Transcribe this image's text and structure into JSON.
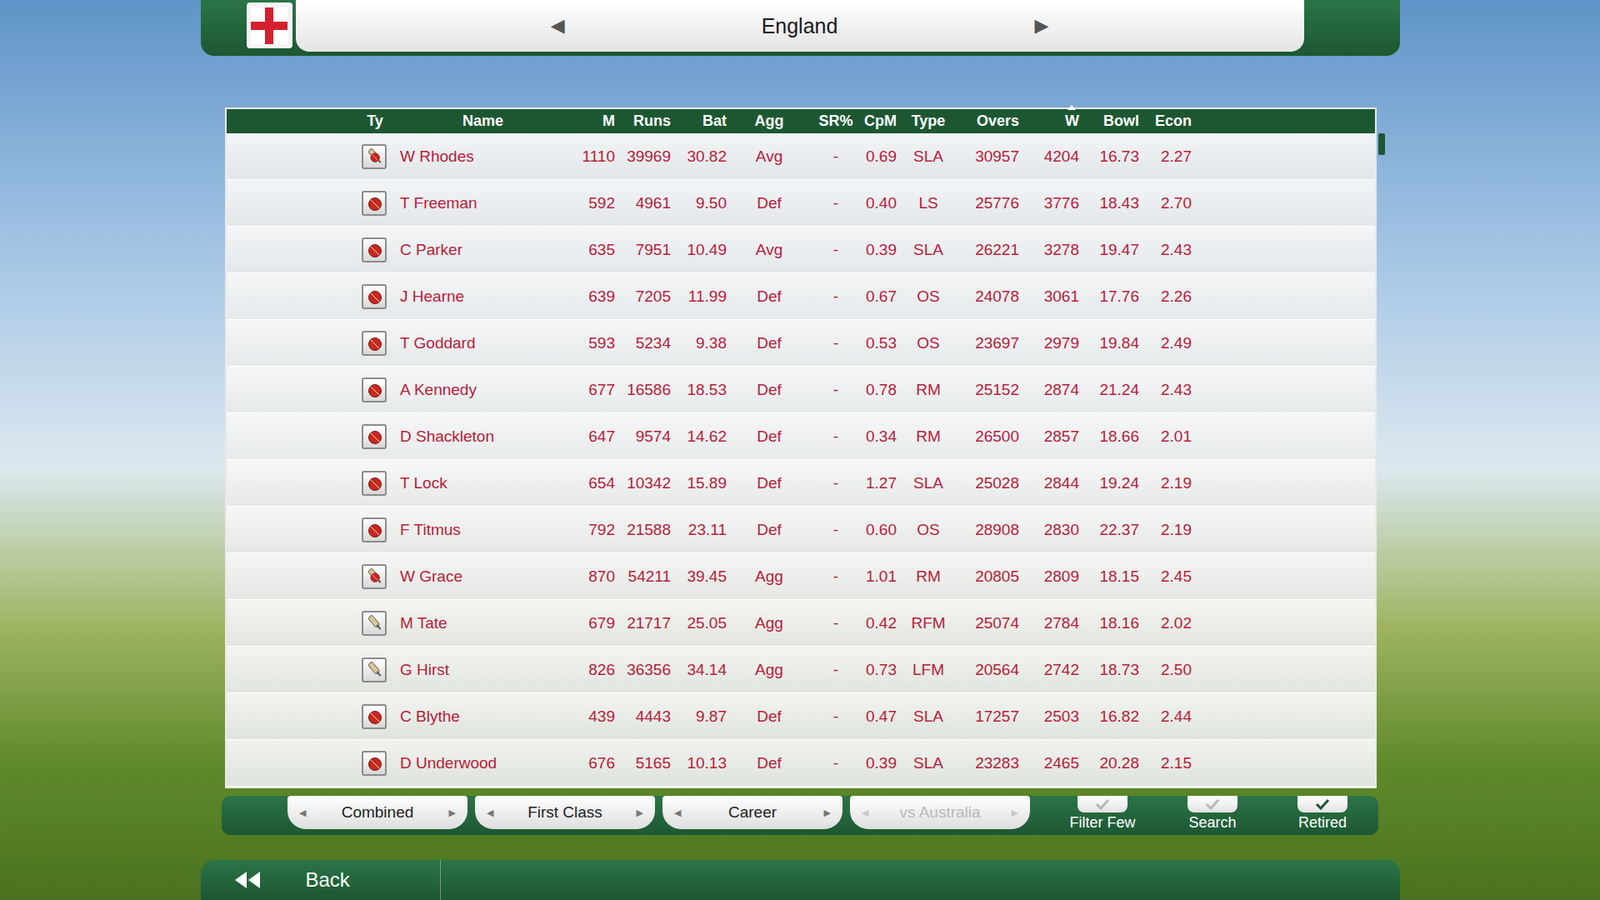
{
  "header": {
    "title": "England",
    "prev": "◀",
    "next": "▶"
  },
  "table": {
    "columns": [
      {
        "label": "Ty",
        "sorted": false
      },
      {
        "label": "Name",
        "sorted": false
      },
      {
        "label": "M",
        "sorted": false
      },
      {
        "label": "Runs",
        "sorted": false
      },
      {
        "label": "Bat",
        "sorted": false
      },
      {
        "label": "Agg",
        "sorted": false
      },
      {
        "label": "SR%",
        "sorted": false
      },
      {
        "label": "CpM",
        "sorted": false
      },
      {
        "label": "Type",
        "sorted": false
      },
      {
        "label": "Overs",
        "sorted": false
      },
      {
        "label": "W",
        "sorted": true
      },
      {
        "label": "Bowl",
        "sorted": false
      },
      {
        "label": "Econ",
        "sorted": false
      }
    ],
    "rows": [
      {
        "kind": "allrounder",
        "cells": [
          "W Rhodes",
          "1110",
          "39969",
          "30.82",
          "Avg",
          "-",
          "0.69",
          "SLA",
          "30957",
          "4204",
          "16.73",
          "2.27"
        ]
      },
      {
        "kind": "bowler",
        "cells": [
          "T Freeman",
          "592",
          "4961",
          "9.50",
          "Def",
          "-",
          "0.40",
          "LS",
          "25776",
          "3776",
          "18.43",
          "2.70"
        ]
      },
      {
        "kind": "bowler",
        "cells": [
          "C Parker",
          "635",
          "7951",
          "10.49",
          "Avg",
          "-",
          "0.39",
          "SLA",
          "26221",
          "3278",
          "19.47",
          "2.43"
        ]
      },
      {
        "kind": "bowler",
        "cells": [
          "J Hearne",
          "639",
          "7205",
          "11.99",
          "Def",
          "-",
          "0.67",
          "OS",
          "24078",
          "3061",
          "17.76",
          "2.26"
        ]
      },
      {
        "kind": "bowler",
        "cells": [
          "T Goddard",
          "593",
          "5234",
          "9.38",
          "Def",
          "-",
          "0.53",
          "OS",
          "23697",
          "2979",
          "19.84",
          "2.49"
        ]
      },
      {
        "kind": "bowler",
        "cells": [
          "A Kennedy",
          "677",
          "16586",
          "18.53",
          "Def",
          "-",
          "0.78",
          "RM",
          "25152",
          "2874",
          "21.24",
          "2.43"
        ]
      },
      {
        "kind": "bowler",
        "cells": [
          "D Shackleton",
          "647",
          "9574",
          "14.62",
          "Def",
          "-",
          "0.34",
          "RM",
          "26500",
          "2857",
          "18.66",
          "2.01"
        ]
      },
      {
        "kind": "bowler",
        "cells": [
          "T Lock",
          "654",
          "10342",
          "15.89",
          "Def",
          "-",
          "1.27",
          "SLA",
          "25028",
          "2844",
          "19.24",
          "2.19"
        ]
      },
      {
        "kind": "bowler",
        "cells": [
          "F Titmus",
          "792",
          "21588",
          "23.11",
          "Def",
          "-",
          "0.60",
          "OS",
          "28908",
          "2830",
          "22.37",
          "2.19"
        ]
      },
      {
        "kind": "allrounder",
        "cells": [
          "W Grace",
          "870",
          "54211",
          "39.45",
          "Agg",
          "-",
          "1.01",
          "RM",
          "20805",
          "2809",
          "18.15",
          "2.45"
        ]
      },
      {
        "kind": "batsman",
        "cells": [
          "M Tate",
          "679",
          "21717",
          "25.05",
          "Agg",
          "-",
          "0.42",
          "RFM",
          "25074",
          "2784",
          "18.16",
          "2.02"
        ]
      },
      {
        "kind": "batsman",
        "cells": [
          "G Hirst",
          "826",
          "36356",
          "34.14",
          "Agg",
          "-",
          "0.73",
          "LFM",
          "20564",
          "2742",
          "18.73",
          "2.50"
        ]
      },
      {
        "kind": "bowler",
        "cells": [
          "C Blythe",
          "439",
          "4443",
          "9.87",
          "Def",
          "-",
          "0.47",
          "SLA",
          "17257",
          "2503",
          "16.82",
          "2.44"
        ]
      },
      {
        "kind": "bowler",
        "cells": [
          "D Underwood",
          "676",
          "5165",
          "10.13",
          "Def",
          "-",
          "0.39",
          "SLA",
          "23283",
          "2465",
          "20.28",
          "2.15"
        ]
      }
    ]
  },
  "filters": [
    {
      "label": "Combined",
      "disabled": false,
      "prev": "◀",
      "next": "▶"
    },
    {
      "label": "First Class",
      "disabled": false,
      "prev": "◀",
      "next": "▶"
    },
    {
      "label": "Career",
      "disabled": false,
      "prev": "◀",
      "next": "▶"
    },
    {
      "label": "vs Australia",
      "disabled": true,
      "prev": "◀",
      "next": "▶"
    }
  ],
  "toggles": [
    {
      "label": "Filter Few",
      "checked": false
    },
    {
      "label": "Search",
      "checked": false
    },
    {
      "label": "Retired",
      "checked": true
    }
  ],
  "back": {
    "label": "Back"
  }
}
